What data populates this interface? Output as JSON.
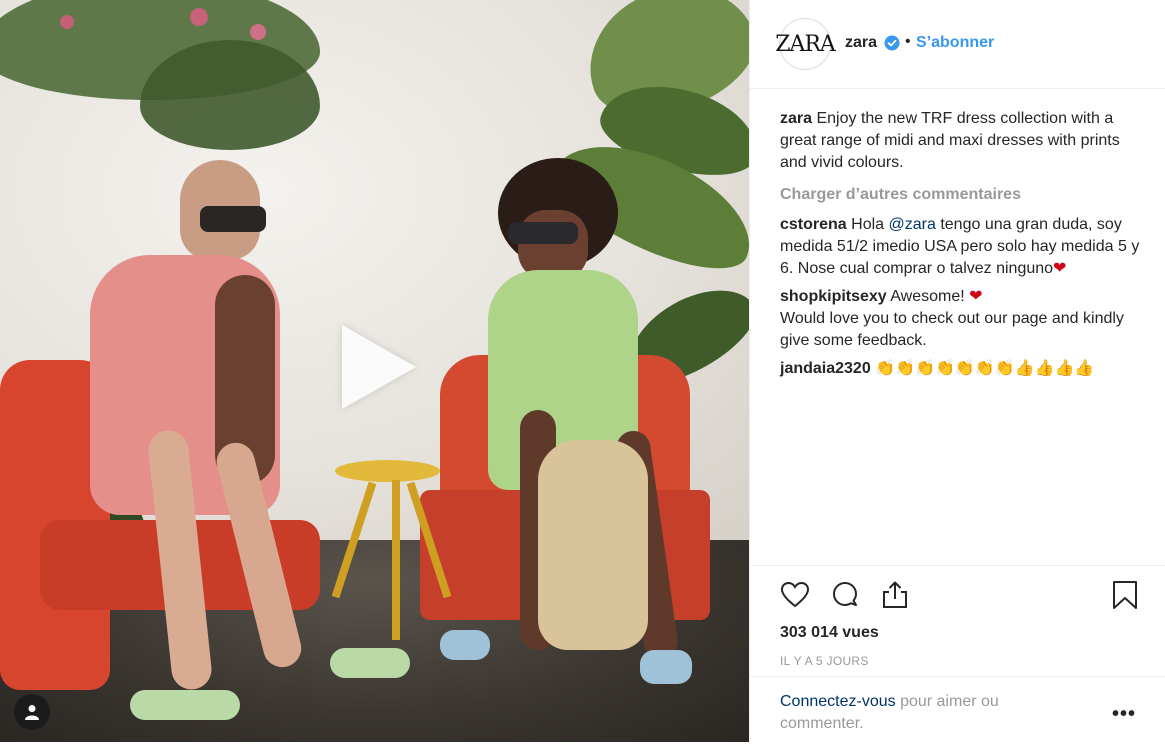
{
  "header": {
    "avatar_text": "ZARA",
    "username": "zara",
    "separator": "•",
    "follow_label": "S’abonner"
  },
  "caption": {
    "username": "zara",
    "text": "Enjoy the new TRF dress collection with a great range of midi and maxi dresses with prints and vivid colours."
  },
  "load_more": "Charger d’autres commentaires",
  "comments": [
    {
      "username": "cstorena",
      "text_before": "Hola ",
      "mention": "@zara",
      "text_after": " tengo una gran duda, soy medida 51/2 imedio USA pero solo hay medida 5 y 6. Nose cual comprar o talvez ninguno",
      "emoji": "❤"
    },
    {
      "username": "shopkipitsexy",
      "text": "Awesome! ",
      "emoji": "❤",
      "text_after": "Would love you to check out our page and kindly give some feedback."
    },
    {
      "username": "jandaia2320",
      "text": "👏👏👏👏👏👏👏👍👍👍👍"
    }
  ],
  "stats": {
    "views": "303 014 vues",
    "time": "IL Y A 5 JOURS"
  },
  "login": {
    "link": "Connectez-vous",
    "text": " pour aimer ou commenter.",
    "more": "•••"
  },
  "icons": {
    "like": "heart-icon",
    "comment": "comment-icon",
    "share": "share-icon",
    "save": "bookmark-icon",
    "play": "play-icon",
    "user_tag": "user-icon"
  },
  "colors": {
    "accent": "#3897f0",
    "link": "#003569",
    "muted": "#999999",
    "text": "#262626"
  }
}
